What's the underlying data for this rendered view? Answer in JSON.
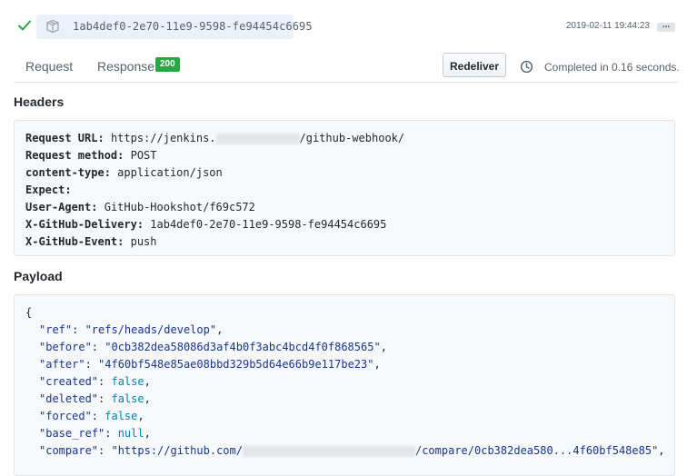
{
  "delivery": {
    "guid": "1ab4def0-2e70-11e9-9598-fe94454c6695",
    "timestamp": "2019-02-11 19:44:23",
    "more_label": "...",
    "status_icon": "check-icon",
    "type_icon": "box-icon"
  },
  "tabs": {
    "request_label": "Request",
    "response_label": "Response",
    "response_status": "200",
    "redeliver_label": "Redeliver",
    "completed_text": "Completed in 0.16 seconds."
  },
  "headers": {
    "title": "Headers",
    "lines": [
      {
        "key": "Request URL:",
        "value_prefix": "https://jenkins.",
        "value_suffix": "/github-webhook/"
      },
      {
        "key": "Request method:",
        "value": "POST"
      },
      {
        "key": "content-type:",
        "value": "application/json"
      },
      {
        "key": "Expect:",
        "value": ""
      },
      {
        "key": "User-Agent:",
        "value": "GitHub-Hookshot/f69c572"
      },
      {
        "key": "X-GitHub-Delivery:",
        "value": "1ab4def0-2e70-11e9-9598-fe94454c6695"
      },
      {
        "key": "X-GitHub-Event:",
        "value": "push"
      }
    ]
  },
  "payload": {
    "title": "Payload",
    "open_brace": "{",
    "lines": [
      {
        "key": "\"ref\"",
        "value": "\"refs/heads/develop\"",
        "kind": "str"
      },
      {
        "key": "\"before\"",
        "value": "\"0cb382dea58086d3af4b0f3abc4bcd4f0f868565\"",
        "kind": "str"
      },
      {
        "key": "\"after\"",
        "value": "\"4f60bf548e85ae08bbd329b5d64e66b9e117be23\"",
        "kind": "str"
      },
      {
        "key": "\"created\"",
        "value": "false",
        "kind": "lit"
      },
      {
        "key": "\"deleted\"",
        "value": "false",
        "kind": "lit"
      },
      {
        "key": "\"forced\"",
        "value": "false",
        "kind": "lit"
      },
      {
        "key": "\"base_ref\"",
        "value": "null",
        "kind": "lit"
      },
      {
        "key": "\"compare\"",
        "value_prefix": "\"https://github.com/",
        "value_suffix": "/compare/0cb382dea580...4f60bf548e85\"",
        "kind": "str"
      }
    ]
  },
  "colors": {
    "success": "#28a745",
    "code_bg": "#f6f8fa",
    "pill_bg": "#eaf1fb",
    "string": "#183691",
    "literal": "#0086b3"
  }
}
